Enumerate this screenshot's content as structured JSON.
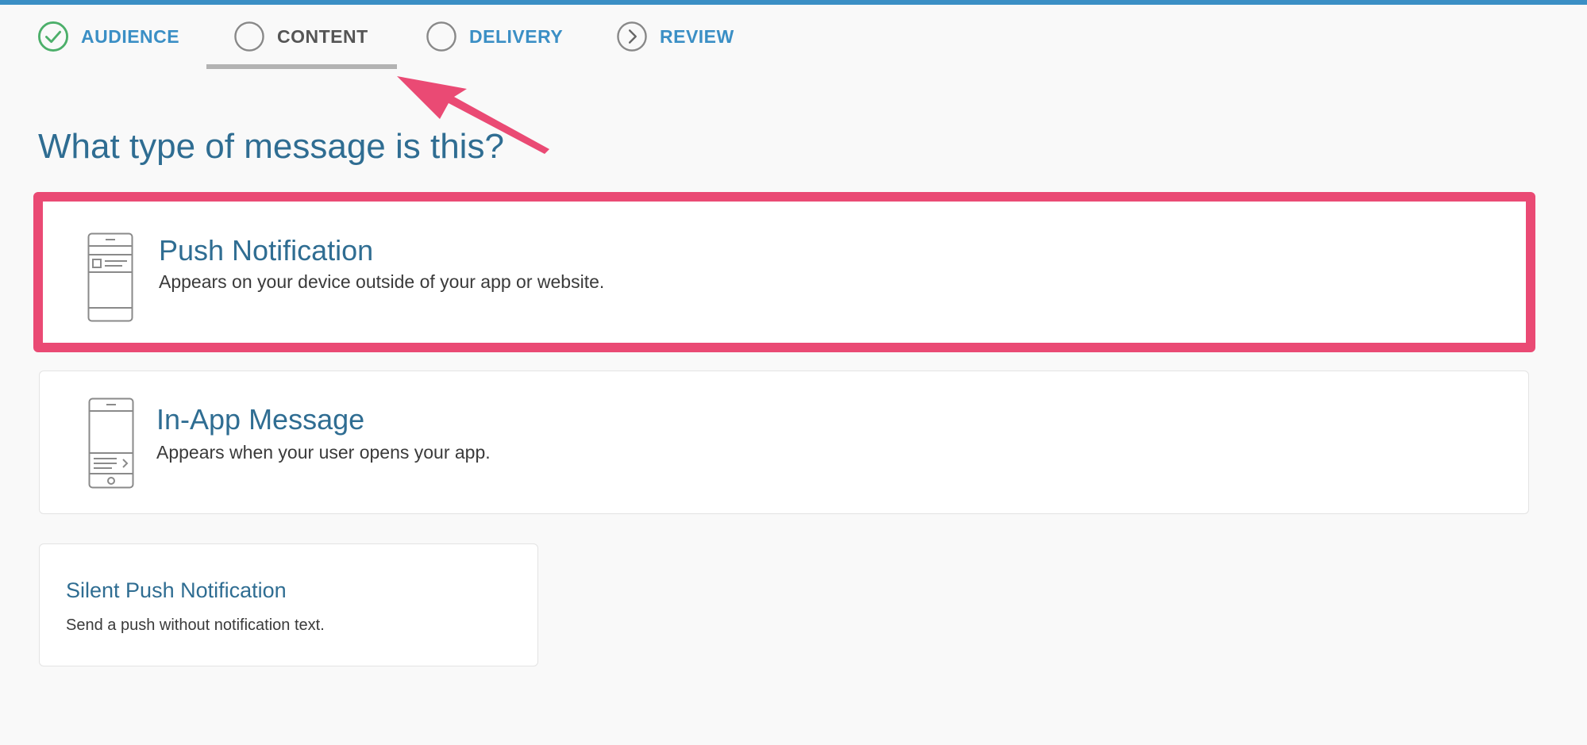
{
  "steps": [
    {
      "label": "AUDIENCE",
      "status": "complete",
      "icon": "check-circle-icon"
    },
    {
      "label": "CONTENT",
      "status": "active",
      "icon": "empty-circle-icon"
    },
    {
      "label": "DELIVERY",
      "status": "pending",
      "icon": "empty-circle-icon"
    },
    {
      "label": "REVIEW",
      "status": "pending",
      "icon": "chevron-right-circle-icon"
    }
  ],
  "heading": "What type of message is this?",
  "options": [
    {
      "title": "Push Notification",
      "description": "Appears on your device outside of your app or website.",
      "icon": "phone-push-icon",
      "highlighted": true
    },
    {
      "title": "In-App Message",
      "description": "Appears when your user opens your app.",
      "icon": "phone-in-app-icon",
      "highlighted": false
    },
    {
      "title": "Silent Push Notification",
      "description": "Send a push without notification text.",
      "icon": null,
      "highlighted": false
    }
  ],
  "colors": {
    "accent": "#3b8fc5",
    "heading": "#2f6d92",
    "complete": "#4caf6a",
    "annotation": "#ea4a74",
    "inactive": "#9a9a9a"
  }
}
